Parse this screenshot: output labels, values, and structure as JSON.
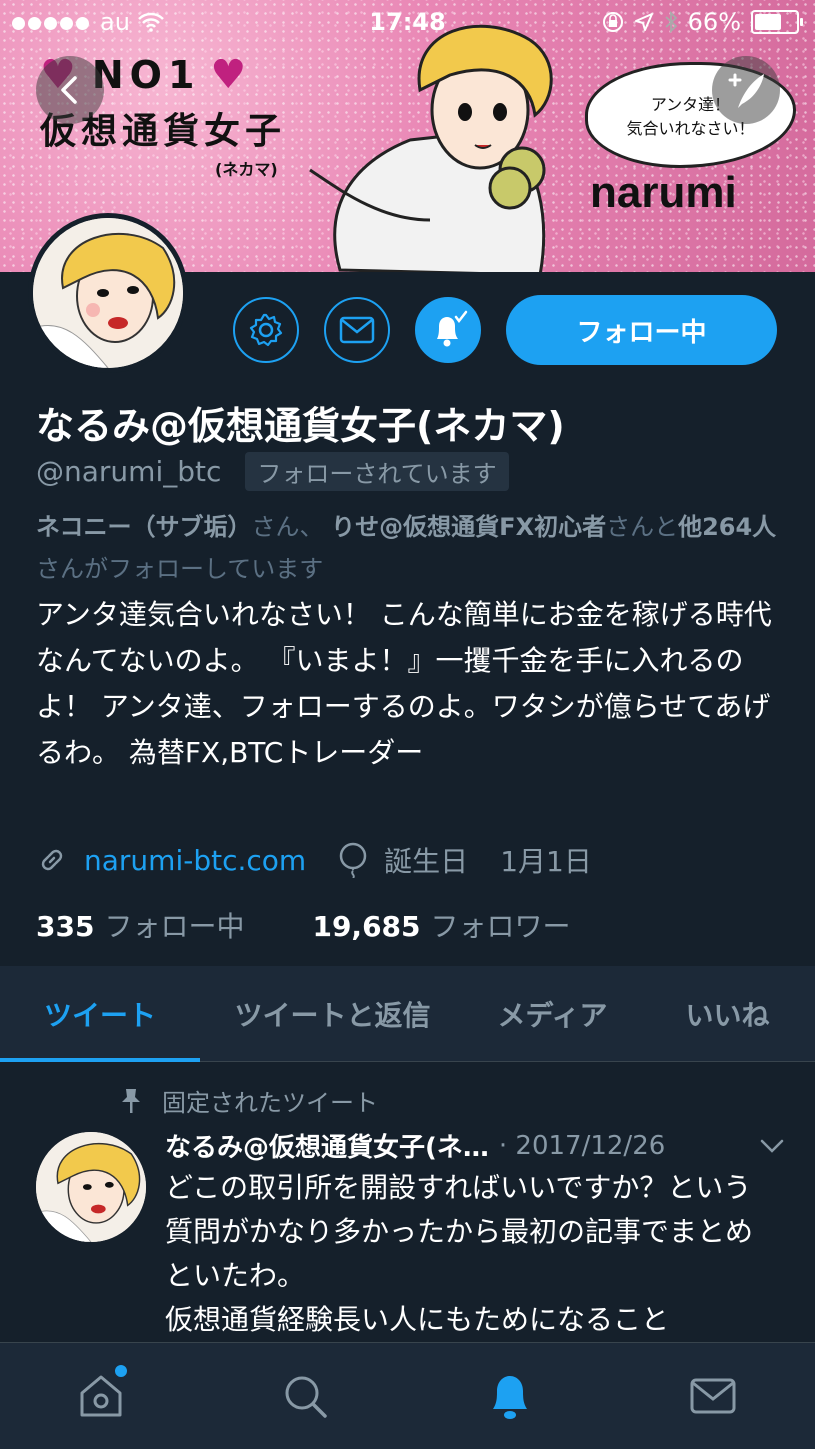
{
  "status_bar": {
    "carrier": "au",
    "time": "17:48",
    "battery": "66%"
  },
  "banner": {
    "rank": "NO1",
    "title": "仮想通貨女子",
    "subtitle": "(ネカマ)",
    "bubble_line1": "アンタ達！",
    "bubble_line2": "気合いれなさい！",
    "brand": "narumi"
  },
  "profile": {
    "name": "なるみ@仮想通貨女子(ネカマ)",
    "handle": "@narumi_btc",
    "follows_you": "フォローされています",
    "follow_button": "フォロー中",
    "mutual_user1": "ネコニー（サブ垢）",
    "mutual_sep1": "さん、",
    "mutual_user2": "りせ@仮想通貨FX初心者",
    "mutual_sep2": "さんと",
    "mutual_others": "他264人",
    "mutual_suffix": "さんがフォローしています",
    "bio": "アンタ達気合いれなさい！ こんな簡単にお金を稼げる時代なんてないのよ。 『いまよ！』一攫千金を手に入れるのよ！ アンタ達、フォローするのよ。ワタシが億らせてあげるわ。 為替FX,BTCトレーダー",
    "website": "narumi-btc.com",
    "birthday_label": "誕生日",
    "birthday": "1月1日",
    "following_count": "335",
    "following_label": "フォロー中",
    "followers_count": "19,685",
    "followers_label": "フォロワー"
  },
  "tabs": [
    "ツイート",
    "ツイートと返信",
    "メディア",
    "いいね"
  ],
  "pinned_tweet": {
    "pinned_label": "固定されたツイート",
    "author": "なるみ@仮想通貨女子(ネ…",
    "date": "· 2017/12/26",
    "text": "どこの取引所を開設すればいいですか？という質問がかなり多かったから最初の記事でまとめといたわ。\n仮想通貨経験長い人にもためになること"
  },
  "colors": {
    "background": "#15202b",
    "accent": "#1da1f2",
    "secondary_text": "#8899a6"
  },
  "icons": {
    "nav": [
      "home-icon",
      "search-icon",
      "notifications-bell-icon",
      "messages-icon"
    ]
  }
}
